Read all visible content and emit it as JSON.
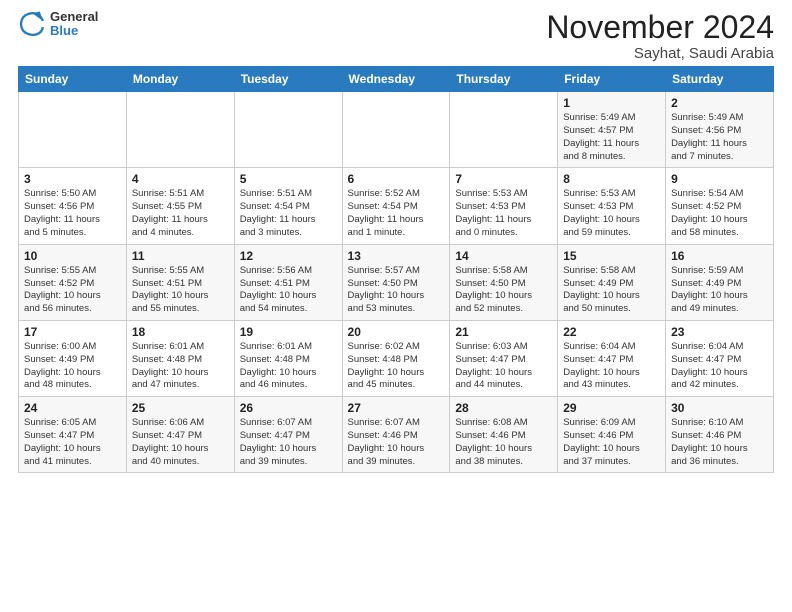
{
  "header": {
    "logo_general": "General",
    "logo_blue": "Blue",
    "month_title": "November 2024",
    "subtitle": "Sayhat, Saudi Arabia"
  },
  "weekdays": [
    "Sunday",
    "Monday",
    "Tuesday",
    "Wednesday",
    "Thursday",
    "Friday",
    "Saturday"
  ],
  "weeks": [
    [
      {
        "day": "",
        "info": ""
      },
      {
        "day": "",
        "info": ""
      },
      {
        "day": "",
        "info": ""
      },
      {
        "day": "",
        "info": ""
      },
      {
        "day": "",
        "info": ""
      },
      {
        "day": "1",
        "info": "Sunrise: 5:49 AM\nSunset: 4:57 PM\nDaylight: 11 hours\nand 8 minutes."
      },
      {
        "day": "2",
        "info": "Sunrise: 5:49 AM\nSunset: 4:56 PM\nDaylight: 11 hours\nand 7 minutes."
      }
    ],
    [
      {
        "day": "3",
        "info": "Sunrise: 5:50 AM\nSunset: 4:56 PM\nDaylight: 11 hours\nand 5 minutes."
      },
      {
        "day": "4",
        "info": "Sunrise: 5:51 AM\nSunset: 4:55 PM\nDaylight: 11 hours\nand 4 minutes."
      },
      {
        "day": "5",
        "info": "Sunrise: 5:51 AM\nSunset: 4:54 PM\nDaylight: 11 hours\nand 3 minutes."
      },
      {
        "day": "6",
        "info": "Sunrise: 5:52 AM\nSunset: 4:54 PM\nDaylight: 11 hours\nand 1 minute."
      },
      {
        "day": "7",
        "info": "Sunrise: 5:53 AM\nSunset: 4:53 PM\nDaylight: 11 hours\nand 0 minutes."
      },
      {
        "day": "8",
        "info": "Sunrise: 5:53 AM\nSunset: 4:53 PM\nDaylight: 10 hours\nand 59 minutes."
      },
      {
        "day": "9",
        "info": "Sunrise: 5:54 AM\nSunset: 4:52 PM\nDaylight: 10 hours\nand 58 minutes."
      }
    ],
    [
      {
        "day": "10",
        "info": "Sunrise: 5:55 AM\nSunset: 4:52 PM\nDaylight: 10 hours\nand 56 minutes."
      },
      {
        "day": "11",
        "info": "Sunrise: 5:55 AM\nSunset: 4:51 PM\nDaylight: 10 hours\nand 55 minutes."
      },
      {
        "day": "12",
        "info": "Sunrise: 5:56 AM\nSunset: 4:51 PM\nDaylight: 10 hours\nand 54 minutes."
      },
      {
        "day": "13",
        "info": "Sunrise: 5:57 AM\nSunset: 4:50 PM\nDaylight: 10 hours\nand 53 minutes."
      },
      {
        "day": "14",
        "info": "Sunrise: 5:58 AM\nSunset: 4:50 PM\nDaylight: 10 hours\nand 52 minutes."
      },
      {
        "day": "15",
        "info": "Sunrise: 5:58 AM\nSunset: 4:49 PM\nDaylight: 10 hours\nand 50 minutes."
      },
      {
        "day": "16",
        "info": "Sunrise: 5:59 AM\nSunset: 4:49 PM\nDaylight: 10 hours\nand 49 minutes."
      }
    ],
    [
      {
        "day": "17",
        "info": "Sunrise: 6:00 AM\nSunset: 4:49 PM\nDaylight: 10 hours\nand 48 minutes."
      },
      {
        "day": "18",
        "info": "Sunrise: 6:01 AM\nSunset: 4:48 PM\nDaylight: 10 hours\nand 47 minutes."
      },
      {
        "day": "19",
        "info": "Sunrise: 6:01 AM\nSunset: 4:48 PM\nDaylight: 10 hours\nand 46 minutes."
      },
      {
        "day": "20",
        "info": "Sunrise: 6:02 AM\nSunset: 4:48 PM\nDaylight: 10 hours\nand 45 minutes."
      },
      {
        "day": "21",
        "info": "Sunrise: 6:03 AM\nSunset: 4:47 PM\nDaylight: 10 hours\nand 44 minutes."
      },
      {
        "day": "22",
        "info": "Sunrise: 6:04 AM\nSunset: 4:47 PM\nDaylight: 10 hours\nand 43 minutes."
      },
      {
        "day": "23",
        "info": "Sunrise: 6:04 AM\nSunset: 4:47 PM\nDaylight: 10 hours\nand 42 minutes."
      }
    ],
    [
      {
        "day": "24",
        "info": "Sunrise: 6:05 AM\nSunset: 4:47 PM\nDaylight: 10 hours\nand 41 minutes."
      },
      {
        "day": "25",
        "info": "Sunrise: 6:06 AM\nSunset: 4:47 PM\nDaylight: 10 hours\nand 40 minutes."
      },
      {
        "day": "26",
        "info": "Sunrise: 6:07 AM\nSunset: 4:47 PM\nDaylight: 10 hours\nand 39 minutes."
      },
      {
        "day": "27",
        "info": "Sunrise: 6:07 AM\nSunset: 4:46 PM\nDaylight: 10 hours\nand 39 minutes."
      },
      {
        "day": "28",
        "info": "Sunrise: 6:08 AM\nSunset: 4:46 PM\nDaylight: 10 hours\nand 38 minutes."
      },
      {
        "day": "29",
        "info": "Sunrise: 6:09 AM\nSunset: 4:46 PM\nDaylight: 10 hours\nand 37 minutes."
      },
      {
        "day": "30",
        "info": "Sunrise: 6:10 AM\nSunset: 4:46 PM\nDaylight: 10 hours\nand 36 minutes."
      }
    ]
  ]
}
